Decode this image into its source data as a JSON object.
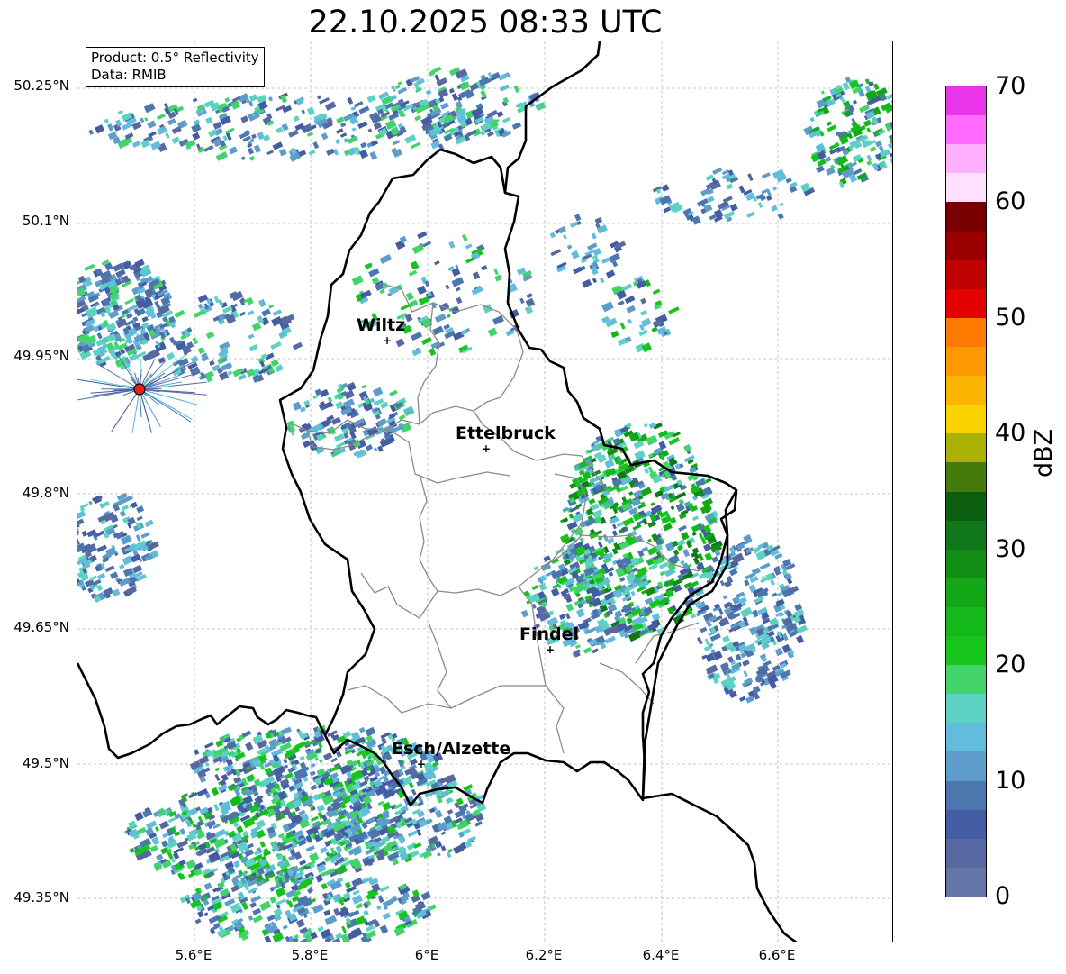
{
  "title": "22.10.2025 08:33 UTC",
  "info": {
    "product": "Product: 0.5° Reflectivity",
    "source": "Data: RMIB"
  },
  "axes": {
    "lat_ticks": [
      "50.25°N",
      "50.1°N",
      "49.95°N",
      "49.8°N",
      "49.65°N",
      "49.5°N",
      "49.35°N"
    ],
    "lon_ticks": [
      "5.6°E",
      "5.8°E",
      "6°E",
      "6.2°E",
      "6.4°E",
      "6.6°E"
    ],
    "gridlines": true
  },
  "cities": [
    {
      "name": "Wiltz",
      "lon": 5.93,
      "lat": 49.967
    },
    {
      "name": "Ettelbruck",
      "lon": 6.1,
      "lat": 49.848
    },
    {
      "name": "Findel",
      "lon": 6.21,
      "lat": 49.627
    },
    {
      "name": "Esch/Alzette",
      "lon": 5.99,
      "lat": 49.5
    }
  ],
  "radar_site": {
    "color": "#e8231e"
  },
  "colorbar": {
    "label": "dBZ",
    "tick_labels": [
      "0",
      "10",
      "20",
      "30",
      "40",
      "50",
      "60",
      "70"
    ],
    "colors": [
      "#6477a8",
      "#5669a2",
      "#445ca1",
      "#4c77ae",
      "#5e9cc9",
      "#62bcdb",
      "#5dd2c3",
      "#42d46a",
      "#16c51b",
      "#14b81a",
      "#13a715",
      "#118d13",
      "#10771a",
      "#0b5d10",
      "#457a0c",
      "#aab305",
      "#fad400",
      "#fbb400",
      "#fc9800",
      "#fd7b00",
      "#e30000",
      "#bf0000",
      "#9b0000",
      "#7a0000",
      "#ffe0ff",
      "#ffb0ff",
      "#ff6cff",
      "#e935e9"
    ]
  }
}
